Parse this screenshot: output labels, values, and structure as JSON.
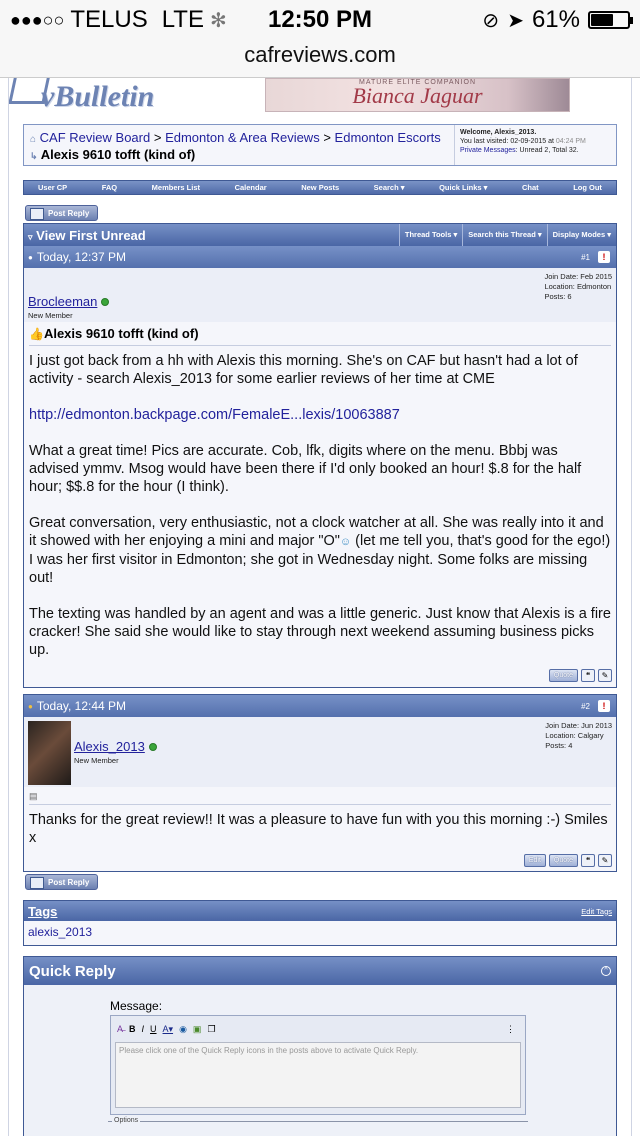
{
  "statusbar": {
    "signal": "●●●○○",
    "carrier": "TELUS",
    "network": "LTE",
    "time": "12:50 PM",
    "battery": "61%",
    "battery_level": 0.61
  },
  "browser": {
    "url": "cafreviews.com"
  },
  "header": {
    "logo": "vBulletin",
    "banner_small": "MATURE ELITE COMPANION",
    "banner_name": "Bianca Jaguar"
  },
  "breadcrumb": {
    "items": [
      "CAF Review Board",
      "Edmonton & Area Reviews",
      "Edmonton Escorts"
    ],
    "sep": ">",
    "title": "Alexis 9610 tofft (kind of)"
  },
  "welcome": {
    "line1": "Welcome, Alexis_2013.",
    "visited_label": "You last visited: 02-09-2015 at",
    "visited_time": "04:24 PM",
    "pm_link": "Private Messages",
    "pm_text": ": Unread 2, Total 32."
  },
  "menu": [
    "User CP",
    "FAQ",
    "Members List",
    "Calendar",
    "New Posts",
    "Search ▾",
    "Quick Links ▾",
    "Chat",
    "Log Out"
  ],
  "post_reply_label": "Post Reply",
  "thread": {
    "view_first_unread": "View First Unread",
    "tools": [
      "Thread Tools ▾",
      "Search this Thread ▾",
      "Display Modes ▾"
    ]
  },
  "posts": [
    {
      "date": "Today, 12:37 PM",
      "number": "#1",
      "username": "Brocleeman",
      "rank": "New Member",
      "join_date": "Join Date: Feb 2015",
      "location": "Location: Edmonton",
      "posts": "Posts: 6",
      "title": "Alexis 9610 tofft (kind of)",
      "p1": "I just got back from a hh with Alexis this morning. She's on CAF but hasn't had a lot of activity - search Alexis_2013 for some earlier reviews of her time at CME",
      "link": "http://edmonton.backpage.com/FemaleE...lexis/10063887",
      "p2": "What a great time! Pics are accurate. Cob, lfk, digits where on the menu. Bbbj was advised ymmv. Msog would have been there if I'd only booked an hour! $.8 for the half hour; $$.8 for the hour (I think).",
      "p3": "Great conversation, very enthusiastic, not a clock watcher at all. She was really into it and it showed with her enjoying a mini and major \"O\"",
      "p3b": " (let me tell you, that's good for the ego!) I was her first visitor in Edmonton; she got in Wednesday night. Some folks are missing out!",
      "p4": "The texting was handled by an agent and was a little generic. Just know that Alexis is a fire cracker! She said she would like to stay through next weekend assuming business picks up.",
      "quote_label": "Quote"
    },
    {
      "date": "Today, 12:44 PM",
      "number": "#2",
      "username": "Alexis_2013",
      "rank": "New Member",
      "join_date": "Join Date: Jun 2013",
      "location": "Location: Calgary",
      "posts": "Posts: 4",
      "message": "Thanks for the great review!! It was a pleasure to have fun with you this morning :-) Smiles x",
      "edit_label": "Edit",
      "quote_label": "Quote"
    }
  ],
  "tags": {
    "title": "Tags",
    "edit": "Edit Tags",
    "tag": "alexis_2013"
  },
  "quick_reply": {
    "title": "Quick Reply",
    "message_label": "Message:",
    "placeholder": "Please click one of the Quick Reply icons in the posts above to activate Quick Reply.",
    "options_label": "Options"
  }
}
